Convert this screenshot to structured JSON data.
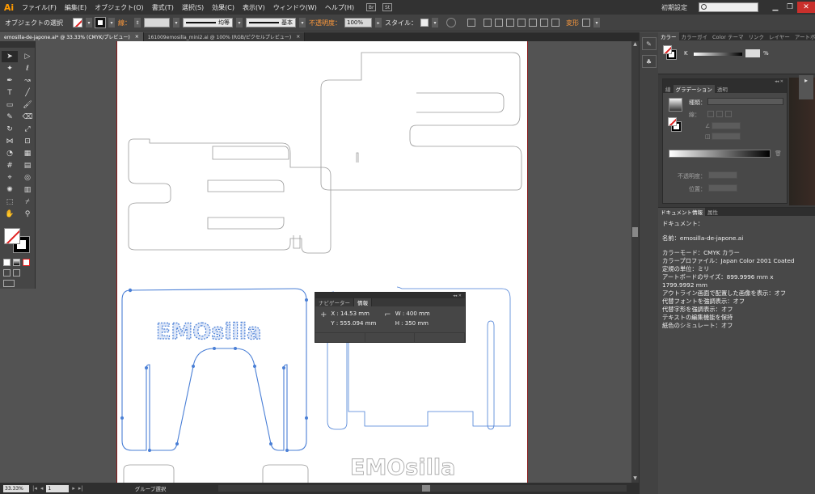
{
  "app": {
    "logo": "Ai"
  },
  "menu": [
    "ファイル(F)",
    "編集(E)",
    "オブジェクト(O)",
    "書式(T)",
    "選択(S)",
    "効果(C)",
    "表示(V)",
    "ウィンドウ(W)",
    "ヘルプ(H)"
  ],
  "menubar_icons": [
    "Br",
    "St"
  ],
  "workspace": "初期設定",
  "control": {
    "selection_label": "オブジェクトの選択",
    "stroke_label": "線：",
    "stroke_profile": "均等",
    "brush_label": "基本",
    "opacity_label": "不透明度：",
    "opacity_value": "100%",
    "style_label": "スタイル：",
    "transform_label": "変形"
  },
  "doc_tabs": [
    {
      "label": "emosilla-de-japone.ai* @ 33.33% (CMYK/プレビュー)",
      "active": true
    },
    {
      "label": "161009emosilla_mini2.ai @ 100% (RGB/ピクセルプレビュー)",
      "active": false
    }
  ],
  "tools": [
    "select-arrow",
    "direct-select",
    "magic-wand",
    "lasso",
    "pen",
    "curvature",
    "type",
    "line",
    "rectangle",
    "paintbrush",
    "shaper",
    "eraser",
    "rotate",
    "scale",
    "width",
    "free-transform",
    "shape-builder",
    "perspective",
    "mesh",
    "gradient",
    "eyedropper",
    "blend",
    "symbol-sprayer",
    "column-graph",
    "artboard",
    "slice",
    "hand",
    "zoom"
  ],
  "artwork": {
    "logo_text": "EMOsilla"
  },
  "info_panel": {
    "tabs": [
      "ナビゲーター",
      "情報"
    ],
    "x": "X : 14.53 mm",
    "y": "Y : 555.094 mm",
    "w": "W : 400 mm",
    "h": "H : 350 mm"
  },
  "status": {
    "zoom": "33.33%",
    "page": "1",
    "text": "グループ選択"
  },
  "color_panel": {
    "tabs": [
      "カラー",
      "カラーガイ",
      "Color テーマ",
      "リンク",
      "レイヤー",
      "アートボー"
    ],
    "channel": "K",
    "unit": "%"
  },
  "gradient_panel": {
    "tabs": [
      "線",
      "グラデーション",
      "透明"
    ],
    "type_label": "種類：",
    "stroke_label": "線：",
    "opacity_label": "不透明度：",
    "position_label": "位置："
  },
  "docinfo": {
    "tabs": [
      "ドキュメント情報",
      "属性"
    ],
    "lines_a": [
      "ドキュメント："
    ],
    "lines_b": [
      "名前：emosilla-de-japone.ai"
    ],
    "lines_c": [
      "カラーモード：CMYK カラー",
      "カラープロファイル：Japan Color 2001 Coated",
      "定規の単位：ミリ",
      "アートボードのサイズ：899.9996 mm x",
      "1799.9992 mm",
      "アウトライン画面で配置した画像を表示：オフ",
      "代替フォントを強調表示：オフ",
      "代替字形を強調表示：オフ",
      "テキストの編集機能を保持",
      "紙色のシミュレート：オフ"
    ]
  },
  "colors": {
    "accent": "#ff9a00",
    "selection": "#4a7fd6",
    "close": "#c9302c"
  }
}
